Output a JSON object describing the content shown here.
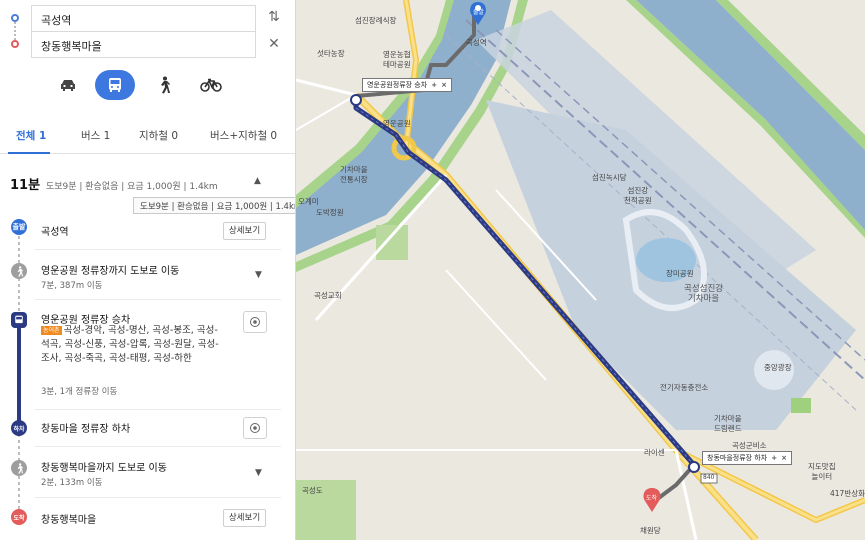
{
  "search": {
    "origin": "곡성역",
    "destination": "창동행복마을"
  },
  "controls": {
    "swap_icon": "⇅",
    "clear_icon": "✕"
  },
  "modes": [
    {
      "name": "car",
      "active": false
    },
    {
      "name": "transit",
      "active": true
    },
    {
      "name": "walk",
      "active": false
    },
    {
      "name": "bike",
      "active": false
    }
  ],
  "tabs": [
    {
      "label": "전체 1",
      "active": true
    },
    {
      "label": "버스 1",
      "active": false
    },
    {
      "label": "지하철 0",
      "active": false
    },
    {
      "label": "버스+지하철 0",
      "active": false
    }
  ],
  "summary": {
    "duration": "11분",
    "details": "도보9분 | 환승없음 | 요금 1,000원 | 1.4km",
    "tooltip": "도보9분 | 환승없음 | 요금 1,000원 | 1.4km"
  },
  "steps": {
    "start": {
      "badge": "출발",
      "title": "곡성역",
      "button": "상세보기"
    },
    "walk1": {
      "title": "영운공원 정류장까지 도보로 이동",
      "sub": "7분, 387m 이동"
    },
    "bus": {
      "title": "영운공원 정류장 승차",
      "tag": "농어촌",
      "routes": "곡성-경악, 곡성-명산, 곡성-봉조, 곡성-석곡, 곡성-신풍, 곡성-압록, 곡성-원달, 곡성-조사, 곡성-죽곡, 곡성-태평, 곡성-하한",
      "sub": "3분, 1개 정류장 이동"
    },
    "alight": {
      "badge": "하차",
      "title": "창동마을 정류장 하차"
    },
    "walk2": {
      "title": "창동행복마을까지 도보로 이동",
      "sub": "2분, 133m 이동"
    },
    "end": {
      "badge": "도착",
      "title": "창동행복마을",
      "button": "상세보기"
    }
  },
  "map": {
    "labels": {
      "funeral": "섬진장례식장",
      "agri": "영운농협\n테마공원",
      "park": "영운공원",
      "market": "섯타농장",
      "kisa": "기차마을\n전통시장",
      "ogye": "오계미",
      "dobak": "도박정원",
      "gokseong_church": "곡성교회",
      "station": "곡성역",
      "theme": "섬진강\n천적공원",
      "rail": "곡성섬진강\n기차마을",
      "rose": "장미공원",
      "central": "중앙광장",
      "steam": "섬진녹시당",
      "power": "전기자동충전소",
      "rail2": "기차마을\n드림랜드",
      "gun": "곡성군비소",
      "baseball": "지도맛집\n놀이터",
      "jeolla": "라이센",
      "church": "곡성교회",
      "hall": "채원당",
      "stadium": "417반상화",
      "jugong": "곡성도"
    },
    "start_pin": "출발",
    "end_pin": "도착",
    "callout_board": "영운공원정류장 승차",
    "callout_alight": "창동마을정류장 하차",
    "road_no": "840",
    "colors": {
      "route_bus": "#2b3a83",
      "route_walk": "#6b6b6b",
      "water": "#7fa7c7",
      "green": "#9bd07a",
      "road": "#f7d55c"
    }
  }
}
